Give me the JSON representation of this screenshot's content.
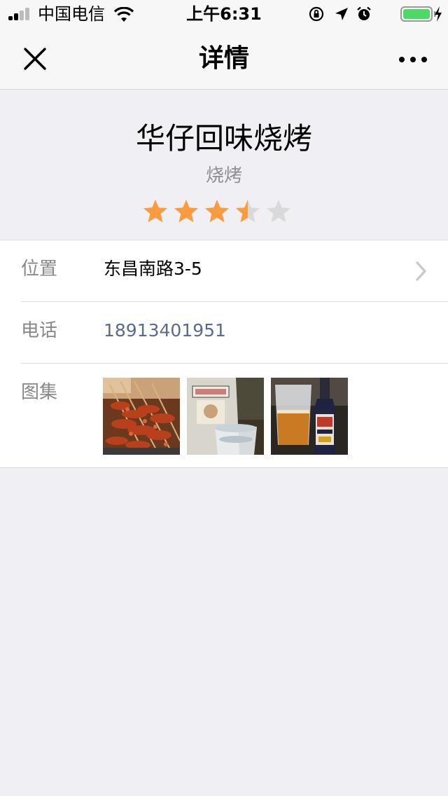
{
  "status_bar": {
    "carrier": "中国电信",
    "time": "上午6:31",
    "battery_level": 1.0
  },
  "nav": {
    "title": "详情",
    "close_icon": "close-icon",
    "more_icon": "more-icon"
  },
  "shop": {
    "name": "华仔回味烧烤",
    "category": "烧烤",
    "rating": 3.5,
    "rating_max": 5
  },
  "details": {
    "location_label": "位置",
    "location_value": "东昌南路3-5",
    "phone_label": "电话",
    "phone_value": "18913401951",
    "gallery_label": "图集",
    "gallery": [
      {
        "icon": "bbq-skewers-photo"
      },
      {
        "icon": "liquor-glass-photo"
      },
      {
        "icon": "beer-bottle-photo"
      }
    ]
  },
  "colors": {
    "star_active": "#fb9b40",
    "star_inactive": "#d9d9d9",
    "phone_link": "#5b6a86",
    "background": "#efeff4"
  }
}
